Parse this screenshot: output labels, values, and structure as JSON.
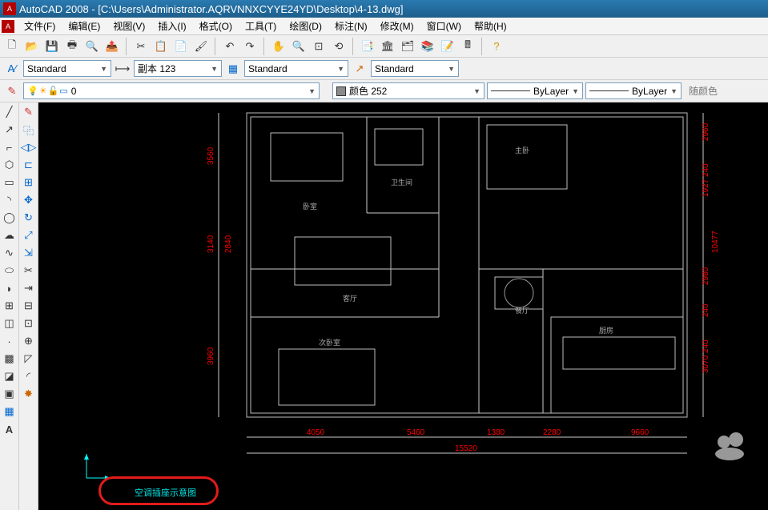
{
  "title": "AutoCAD 2008 - [C:\\Users\\Administrator.AQRVNNXCYYE24YD\\Desktop\\4-13.dwg]",
  "menu": {
    "file": "文件(F)",
    "edit": "编辑(E)",
    "view": "视图(V)",
    "insert": "插入(I)",
    "format": "格式(O)",
    "tools": "工具(T)",
    "draw": "绘图(D)",
    "dimension": "标注(N)",
    "modify": "修改(M)",
    "window": "窗口(W)",
    "help": "帮助(H)"
  },
  "toolbar2": {
    "text_style": "Standard",
    "dim_style": "副本 123",
    "table_style": "Standard",
    "mleader_style": "Standard"
  },
  "toolbar3": {
    "layer_current": "0",
    "color_label": "颜色 252",
    "linetype": "ByLayer",
    "lineweight": "ByLayer",
    "bycolor": "随颜色"
  },
  "canvas": {
    "annotation_text": "空调插座示意图",
    "dims": {
      "d1": "4050",
      "d2": "5460",
      "d3": "1380",
      "d4": "2280",
      "d5": "9660",
      "dtotal": "15520",
      "v1": "2960",
      "v2": "1927 240",
      "v3": "10477",
      "v4": "2980",
      "v5": "240",
      "v6": "3070 240",
      "vleft1": "3560",
      "vleft2": "3140",
      "vleft3": "2840",
      "vleft4": "3960"
    },
    "rooms": {
      "r1": "卧室",
      "r2": "卫生间",
      "r3": "主卧",
      "r4": "客厅",
      "r5": "次卧室",
      "r6": "餐厅",
      "r7": "厨房",
      "r8": "厨房"
    }
  }
}
